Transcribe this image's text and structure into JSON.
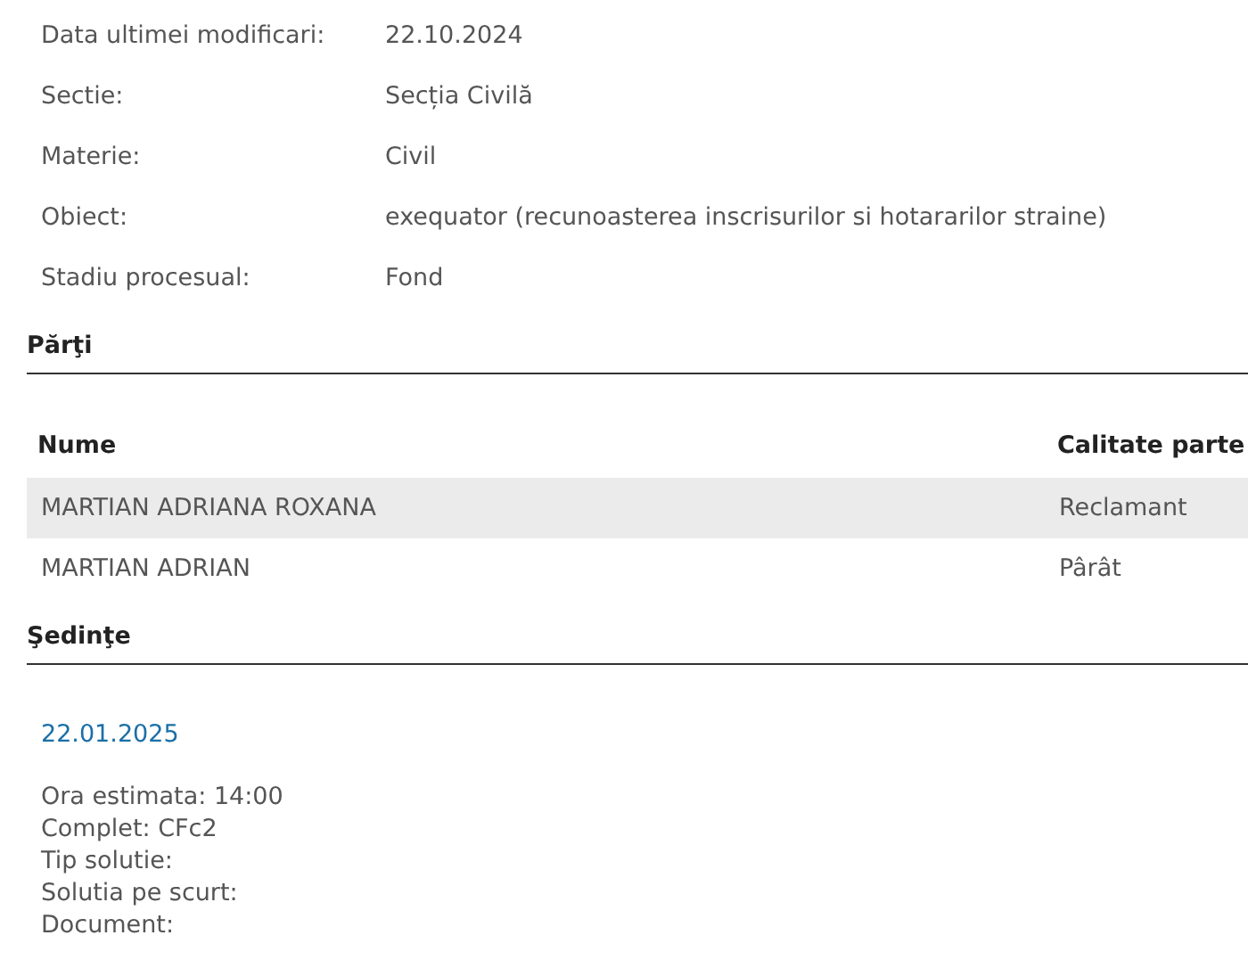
{
  "details": [
    {
      "label": "Data ultimei modificari:",
      "value": "22.10.2024"
    },
    {
      "label": "Sectie:",
      "value": "Secția Civilă"
    },
    {
      "label": "Materie:",
      "value": "Civil"
    },
    {
      "label": "Obiect:",
      "value": "exequator (recunoasterea inscrisurilor si hotararilor straine)"
    },
    {
      "label": "Stadiu procesual:",
      "value": "Fond"
    }
  ],
  "parties": {
    "title": "Părţi",
    "columns": [
      "Nume",
      "Calitate parte"
    ],
    "rows": [
      {
        "name": "MARTIAN ADRIANA ROXANA",
        "role": "Reclamant"
      },
      {
        "name": "MARTIAN ADRIAN",
        "role": "Pârât"
      }
    ]
  },
  "hearings": {
    "title": "Şedinţe",
    "items": [
      {
        "date": "22.01.2025",
        "lines": [
          "Ora estimata: 14:00",
          "Complet: CFc2",
          "Tip solutie:",
          "Solutia pe scurt:",
          "Document:"
        ]
      }
    ]
  }
}
